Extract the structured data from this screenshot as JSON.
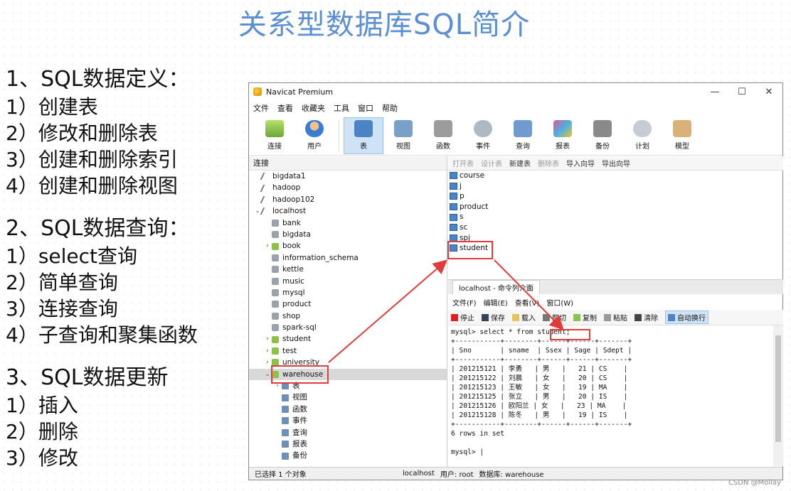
{
  "slide": {
    "title": "关系型数据库SQL简介",
    "sections": [
      {
        "heading": "1、SQL数据定义：",
        "items": [
          "1）创建表",
          "2）修改和删除表",
          "3）创建和删除索引",
          "4）创建和删除视图"
        ]
      },
      {
        "heading": "2、SQL数据查询：",
        "items": [
          "1）select查询",
          "2）简单查询",
          "3）连接查询",
          "4）子查询和聚集函数"
        ]
      },
      {
        "heading": "3、SQL数据更新",
        "items": [
          "1）插入",
          "2）删除",
          "3）修改"
        ]
      }
    ],
    "watermark": "CSDN @Mollay"
  },
  "window": {
    "title": "Navicat Premium",
    "controls": [
      "—",
      "☐",
      "✕"
    ],
    "menu": [
      "文件",
      "查看",
      "收藏夹",
      "工具",
      "窗口",
      "帮助"
    ],
    "toolbar": [
      "连接",
      "用户",
      "表",
      "视图",
      "函数",
      "事件",
      "查询",
      "报表",
      "备份",
      "计划",
      "模型"
    ],
    "conn_label": "连接",
    "tree": [
      {
        "label": "bigdata1",
        "type": "conn",
        "level": 0
      },
      {
        "label": "hadoop",
        "type": "conn",
        "level": 0
      },
      {
        "label": "hadoop102",
        "type": "conn",
        "level": 0
      },
      {
        "label": "localhost",
        "type": "conn",
        "level": 0,
        "expanded": true
      },
      {
        "label": "bank",
        "type": "db",
        "level": 1
      },
      {
        "label": "bigdata",
        "type": "db",
        "level": 1
      },
      {
        "label": "book",
        "type": "dbopen",
        "level": 1,
        "arrow": true
      },
      {
        "label": "information_schema",
        "type": "db",
        "level": 1
      },
      {
        "label": "kettle",
        "type": "db",
        "level": 1
      },
      {
        "label": "music",
        "type": "db",
        "level": 1
      },
      {
        "label": "mysql",
        "type": "db",
        "level": 1
      },
      {
        "label": "product",
        "type": "db",
        "level": 1
      },
      {
        "label": "shop",
        "type": "db",
        "level": 1
      },
      {
        "label": "spark-sql",
        "type": "db",
        "level": 1
      },
      {
        "label": "student",
        "type": "dbopen",
        "level": 1,
        "arrow": true
      },
      {
        "label": "test",
        "type": "dbopen",
        "level": 1,
        "arrow": true
      },
      {
        "label": "university",
        "type": "dbopen",
        "level": 1,
        "arrow": true
      },
      {
        "label": "warehouse",
        "type": "dbopen",
        "level": 1,
        "expanded": true,
        "selected": true
      },
      {
        "label": "表",
        "type": "sub",
        "level": 2,
        "arrow": true
      },
      {
        "label": "视图",
        "type": "sub",
        "level": 2
      },
      {
        "label": "函数",
        "type": "sub",
        "level": 2
      },
      {
        "label": "事件",
        "type": "sub",
        "level": 2
      },
      {
        "label": "查询",
        "type": "sub",
        "level": 2
      },
      {
        "label": "报表",
        "type": "sub",
        "level": 2
      },
      {
        "label": "备份",
        "type": "sub",
        "level": 2
      }
    ],
    "object_toolbar": [
      "打开表",
      "设计表",
      "新建表",
      "删除表",
      "导入向导",
      "导出向导"
    ],
    "tables": [
      "course",
      "j",
      "p",
      "product",
      "s",
      "sc",
      "spj",
      "student"
    ],
    "console": {
      "tab": "localhost - 命令列介面",
      "menu": [
        "文件(F)",
        "编辑(E)",
        "查看(V)",
        "窗口(W)"
      ],
      "toolbar": [
        "停止",
        "保存",
        "载入",
        "剪切",
        "复制",
        "粘贴",
        "清除",
        "自动换行"
      ],
      "lines": [
        "mysql> select * from student;",
        "+-----------+--------+------+------+-------+",
        "| Sno       | sname  | Ssex | Sage | Sdept |",
        "+-----------+--------+------+------+-------+",
        "| 201215121 | 李勇   | 男   |   21 | CS    |",
        "| 201215122 | 刘晨   | 女   |   20 | CS    |",
        "| 201215123 | 王敏   | 女   |   19 | MA    |",
        "| 201215125 | 张立   | 男   |   20 | IS    |",
        "| 201215126 | 欧阳兰 | 女   |   23 | MA    |",
        "| 201215128 | 陈冬   | 男   |   19 | IS    |",
        "+-----------+--------+------+------+-------+",
        "6 rows in set",
        "",
        "mysql> |"
      ]
    },
    "status": {
      "selected": "已选择 1 个对象",
      "conn": "localhost",
      "user": "用户: root",
      "db": "数据库: warehouse"
    }
  }
}
